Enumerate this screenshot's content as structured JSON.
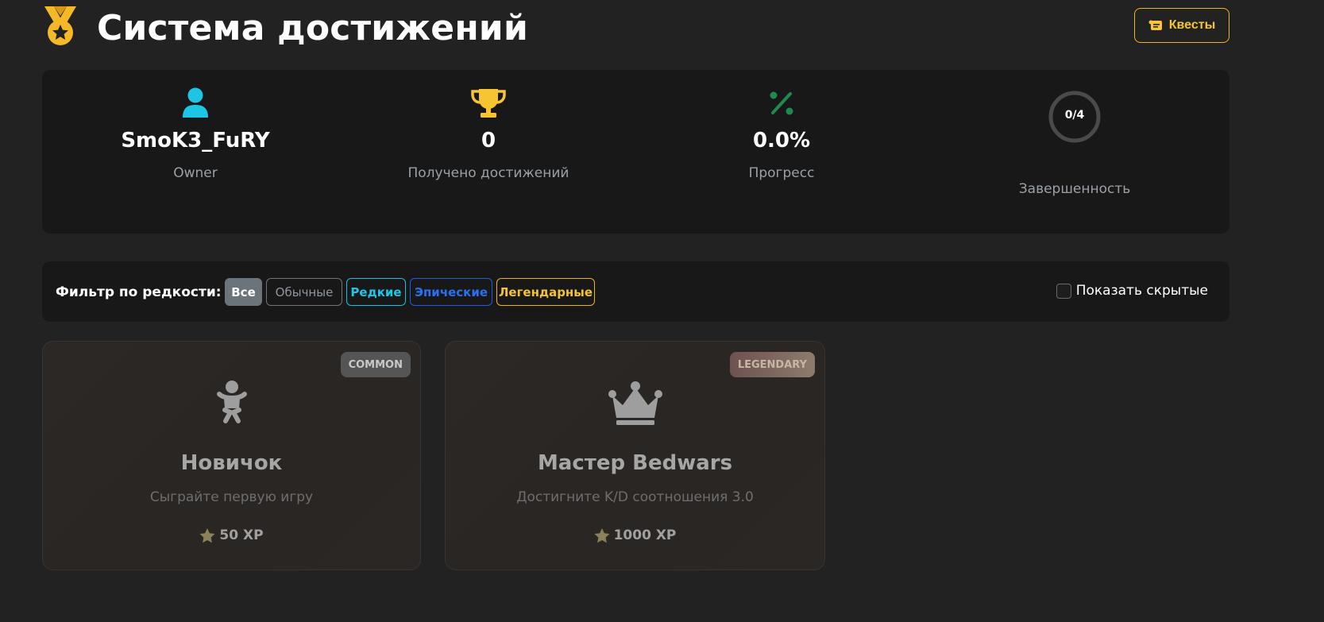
{
  "header": {
    "title": "Система достижений",
    "icon": "medal-icon",
    "quests_button": "Квесты",
    "quests_icon": "scroll-icon",
    "accent": "#f2b51d"
  },
  "stats": {
    "user": {
      "icon": "user-icon",
      "value": "SmoK3_FuRY",
      "label": "Owner",
      "color": "#1ec6e6"
    },
    "achievements": {
      "icon": "trophy-icon",
      "value": "0",
      "label": "Получено достижений",
      "color": "#f7c531"
    },
    "progress": {
      "icon": "percent-icon",
      "value": "0.0%",
      "label": "Прогресс",
      "color": "#1e8a4c"
    },
    "completion": {
      "ring_text": "0/4",
      "label": "Завершенность",
      "fraction": 0.0
    }
  },
  "filter": {
    "label": "Фильтр по редкости:",
    "chips": {
      "all": "Все",
      "common": "Обычные",
      "rare": "Редкие",
      "epic": "Эпические",
      "legendary": "Легендарные"
    },
    "selected": "all",
    "show_hidden_label": "Показать скрытые",
    "show_hidden_checked": false
  },
  "achievements": [
    {
      "rarity_badge": "COMMON",
      "icon": "baby-icon",
      "title": "Новичок",
      "description": "Сыграйте первую игру",
      "xp": "50 XP"
    },
    {
      "rarity_badge": "LEGENDARY",
      "icon": "crown-icon",
      "title": "Мастер Bedwars",
      "description": "Достигните K/D соотношения 3.0",
      "xp": "1000 XP"
    }
  ]
}
